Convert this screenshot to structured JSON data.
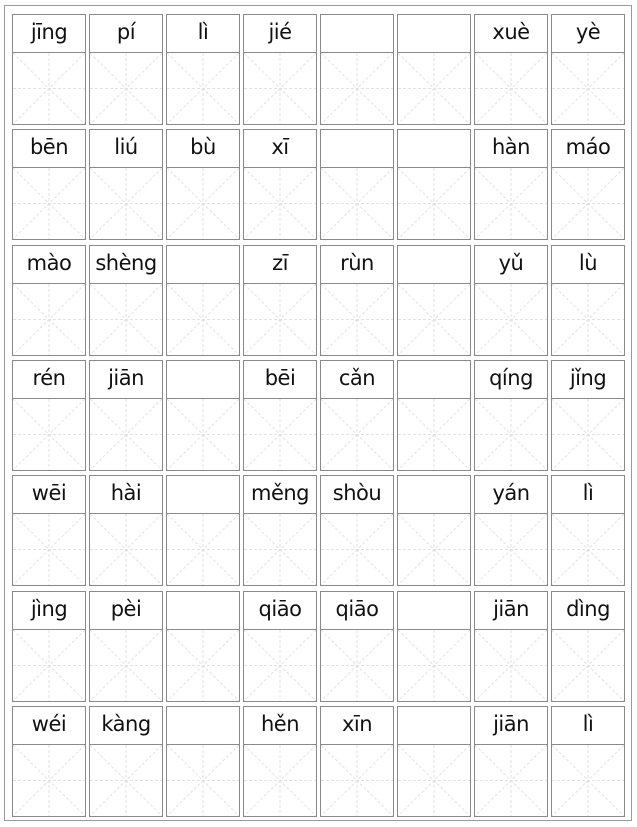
{
  "worksheet": {
    "columns": 8,
    "rows": [
      [
        "jīng",
        "pí",
        "lì",
        "jié",
        "",
        "",
        "xuè",
        "yè"
      ],
      [
        "bēn",
        "liú",
        "bù",
        "xī",
        "",
        "",
        "hàn",
        "máo"
      ],
      [
        "mào",
        "shèng",
        "",
        "zī",
        "rùn",
        "",
        "yǔ",
        "lù"
      ],
      [
        "rén",
        "jiān",
        "",
        "bēi",
        "cǎn",
        "",
        "qíng",
        "jǐng"
      ],
      [
        "wēi",
        "hài",
        "",
        "měng",
        "shòu",
        "",
        "yán",
        "lì"
      ],
      [
        "jìng",
        "pèi",
        "",
        "qiāo",
        "qiāo",
        "",
        "jiān",
        "dìng"
      ],
      [
        "wéi",
        "kàng",
        "",
        "hěn",
        "xīn",
        "",
        "jiān",
        "lì"
      ]
    ],
    "colors": {
      "border": "#8a8a8a",
      "guide": "#e2e2e2",
      "text": "#111111"
    }
  }
}
